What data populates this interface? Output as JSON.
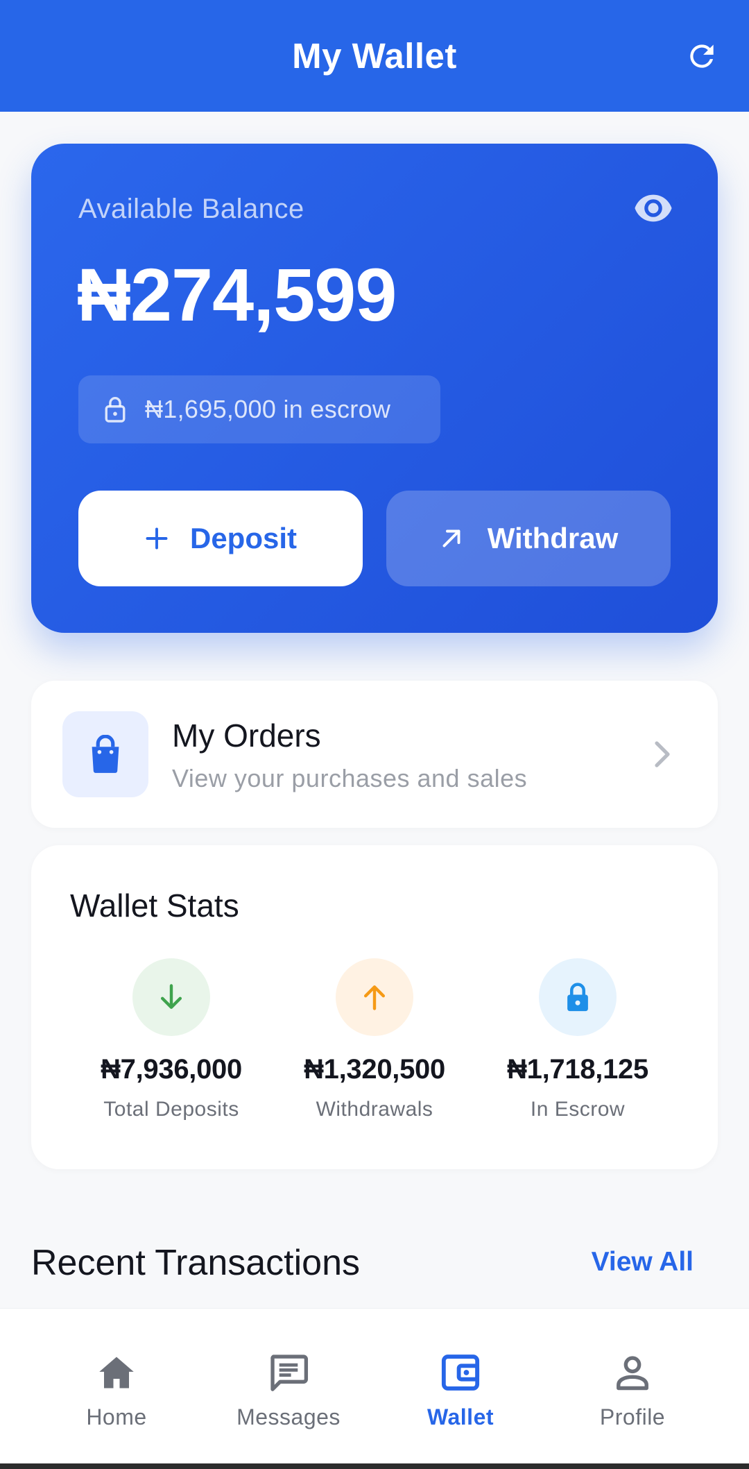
{
  "colors": {
    "primary": "#2766e8",
    "deposit_green": "#3fa34d",
    "withdraw_orange": "#f59a16",
    "escrow_blue": "#1e8fe8"
  },
  "appbar": {
    "title": "My Wallet",
    "refresh_icon": "refresh-icon"
  },
  "balance": {
    "label": "Available Balance",
    "amount": "₦274,599",
    "eye_icon": "eye-icon",
    "escrow_text": "₦1,695,000 in escrow",
    "deposit_label": "Deposit",
    "withdraw_label": "Withdraw"
  },
  "orders": {
    "title": "My Orders",
    "subtitle": "View your purchases and sales"
  },
  "stats": {
    "title": "Wallet Stats",
    "items": [
      {
        "value": "₦7,936,000",
        "label": "Total Deposits",
        "icon": "arrow-down-icon"
      },
      {
        "value": "₦1,320,500",
        "label": "Withdrawals",
        "icon": "arrow-up-icon"
      },
      {
        "value": "₦1,718,125",
        "label": "In Escrow",
        "icon": "lock-icon"
      }
    ]
  },
  "recent": {
    "title": "Recent Transactions",
    "view_all": "View All"
  },
  "nav": {
    "items": [
      {
        "label": "Home",
        "icon": "home-icon",
        "active": false
      },
      {
        "label": "Messages",
        "icon": "message-icon",
        "active": false
      },
      {
        "label": "Wallet",
        "icon": "wallet-icon",
        "active": true
      },
      {
        "label": "Profile",
        "icon": "profile-icon",
        "active": false
      }
    ]
  }
}
